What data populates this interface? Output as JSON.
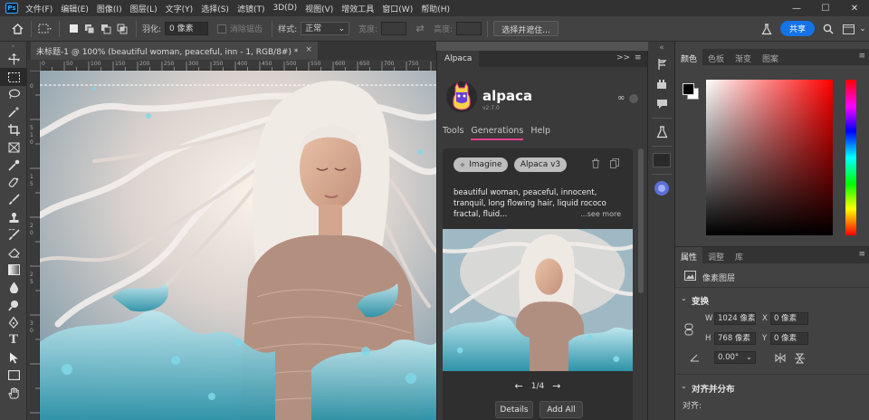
{
  "app": {
    "logo": "Ps"
  },
  "menu": [
    "文件(F)",
    "编辑(E)",
    "图像(I)",
    "图层(L)",
    "文字(Y)",
    "选择(S)",
    "滤镜(T)",
    "3D(D)",
    "视图(V)",
    "增效工具",
    "窗口(W)",
    "帮助(H)"
  ],
  "window_controls": {
    "minimize": "—",
    "maximize": "☐",
    "close": "✕"
  },
  "options": {
    "feather_label": "羽化:",
    "feather_value": "0 像素",
    "antialias_label": "消除锯齿",
    "style_label": "样式:",
    "style_value": "正常",
    "width_label": "宽度:",
    "height_label": "高度:",
    "select_mask_button": "选择并遮住...",
    "share_button": "共享"
  },
  "document": {
    "tab_title": "未标题-1 @ 100% (beautiful woman, peaceful, inn - 1, RGB/8#) *",
    "close": "×",
    "ruler_top": [
      "0",
      "50",
      "100",
      "150",
      "200",
      "250",
      "300",
      "350",
      "400",
      "450",
      "500",
      "550",
      "600",
      "650",
      "700",
      "750"
    ],
    "ruler_left": [
      "0",
      "5",
      "1",
      "0",
      "1",
      "5",
      "2",
      "0",
      "2",
      "5",
      "3",
      "0"
    ]
  },
  "alpaca": {
    "panel_tab": "Alpaca",
    "collapse": ">>",
    "menu": "≡",
    "name": "alpaca",
    "version": "v2.7.0",
    "link_icon": "∞",
    "tabs": [
      "Tools",
      "Generations",
      "Help"
    ],
    "active_tab": "Generations",
    "pills": [
      "Imagine",
      "Alpaca v3"
    ],
    "prompt": "beautiful woman, peaceful, innocent, tranquil, long flowing hair, liquid rococo fractal, fluid...",
    "see_more": "...see more",
    "page": "1/4",
    "details_button": "Details",
    "add_all_button": "Add All"
  },
  "right_panel": {
    "color_tabs": [
      "颜色",
      "色板",
      "渐变",
      "图案"
    ],
    "props_tabs": [
      "属性",
      "调整",
      "库"
    ],
    "layer_type": "像素图层",
    "transform_heading": "变换",
    "w_label": "W",
    "w_value": "1024 像素",
    "h_label": "H",
    "h_value": "768 像素",
    "x_label": "X",
    "x_value": "0 像素",
    "y_label": "Y",
    "y_value": "0 像素",
    "angle_value": "0.00°",
    "align_heading": "对齐并分布",
    "align_label": "对齐:"
  },
  "colors": {
    "accent": "#1473e6",
    "generations_underline": "#e3418f",
    "fg_swatch": "#000000",
    "bg_swatch": "#ffffff"
  },
  "icons": {
    "toolbar": [
      "move-icon",
      "marquee-icon",
      "lasso-icon",
      "magic-wand-icon",
      "crop-icon",
      "frame-icon",
      "eyedropper-icon",
      "spot-heal-icon",
      "brush-icon",
      "clone-stamp-icon",
      "history-brush-icon",
      "eraser-icon",
      "gradient-icon",
      "blur-icon",
      "dodge-icon",
      "pen-icon",
      "type-icon",
      "path-select-icon",
      "rectangle-icon",
      "hand-icon"
    ]
  }
}
